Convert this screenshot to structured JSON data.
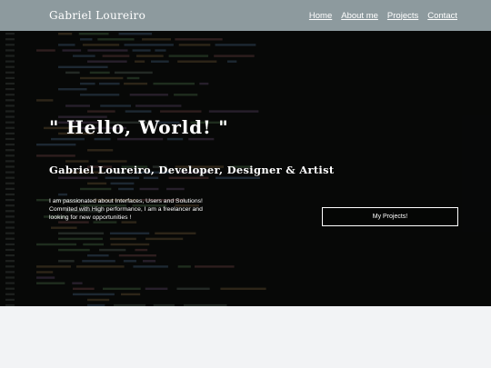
{
  "navbar": {
    "brand": "Gabriel Loureiro",
    "links": [
      "Home",
      "About me",
      "Projects",
      "Contact"
    ]
  },
  "hero": {
    "title": "\" Hello, World! \"",
    "subtitle": "Gabriel Loureiro, Developer, Designer & Artist",
    "text_lines": [
      "I am passionated about Interfaces, Users and Solutions!",
      "Commited with High performance, I am a freelancer and",
      "looking for new opportunities !"
    ],
    "cta_label": "My Projects!"
  },
  "colors": {
    "navbar": "#8d9a9e",
    "hero_bg": "#0b0d0c",
    "page_bg": "#f2f3f5",
    "text": "#ffffff"
  }
}
